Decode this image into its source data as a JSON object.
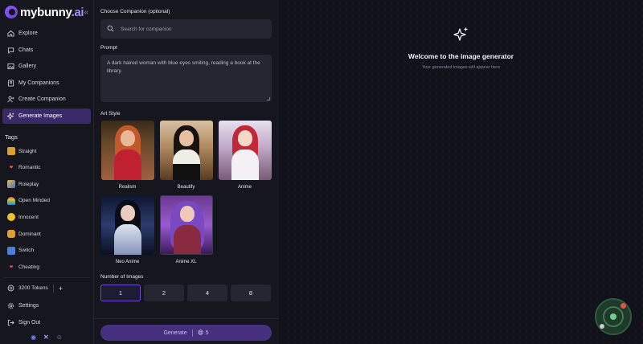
{
  "brand": {
    "name": "mybunny",
    "suffix": ".ai"
  },
  "sidebar": {
    "collapse_icon": "chevrons-left-icon",
    "nav": [
      {
        "label": "Explore",
        "icon": "home-icon",
        "active": false
      },
      {
        "label": "Chats",
        "icon": "chat-icon",
        "active": false
      },
      {
        "label": "Gallery",
        "icon": "gallery-icon",
        "active": false
      },
      {
        "label": "My Companions",
        "icon": "companions-icon",
        "active": false
      },
      {
        "label": "Create Companion",
        "icon": "user-plus-icon",
        "active": false
      },
      {
        "label": "Generate Images",
        "icon": "sparkle-icon",
        "active": true
      }
    ],
    "tags_heading": "Tags",
    "tags": [
      {
        "label": "Straight",
        "icon": "straight-emoji-icon"
      },
      {
        "label": "Romantic",
        "icon": "heart-emoji-icon"
      },
      {
        "label": "Roleplay",
        "icon": "mask-emoji-icon"
      },
      {
        "label": "Open Minded",
        "icon": "rainbow-emoji-icon"
      },
      {
        "label": "Innocent",
        "icon": "smile-emoji-icon"
      },
      {
        "label": "Dominant",
        "icon": "fist-emoji-icon"
      },
      {
        "label": "Switch",
        "icon": "switch-emoji-icon"
      },
      {
        "label": "Cheating",
        "icon": "broken-heart-emoji-icon"
      }
    ],
    "tokens": "3200 Tokens",
    "settings": "Settings",
    "sign_out": "Sign Out",
    "social": [
      "discord-icon",
      "x-icon",
      "reddit-icon"
    ]
  },
  "panel": {
    "companion_label": "Choose Companion (optional)",
    "search_placeholder": "Search for companion",
    "prompt_label": "Prompt",
    "prompt_value": "A dark haired woman with blue eyes smiling, reading a book at the library.",
    "art_style_label": "Art Style",
    "styles": [
      {
        "name": "Realism"
      },
      {
        "name": "Beautify"
      },
      {
        "name": "Anime"
      },
      {
        "name": "Neo Anime"
      },
      {
        "name": "Anime XL"
      }
    ],
    "num_images_label": "Number of Images",
    "counts": [
      "1",
      "2",
      "4",
      "8"
    ],
    "selected_count": "1",
    "generate_label": "Generate",
    "generate_cost": "5"
  },
  "main": {
    "welcome_title": "Welcome to the image generator",
    "welcome_sub": "Your generated images will appear here"
  },
  "colors": {
    "accent": "#6b4bd8",
    "active_nav": "#3a2a6a",
    "generate": "#47307f",
    "background": "#12121b"
  }
}
